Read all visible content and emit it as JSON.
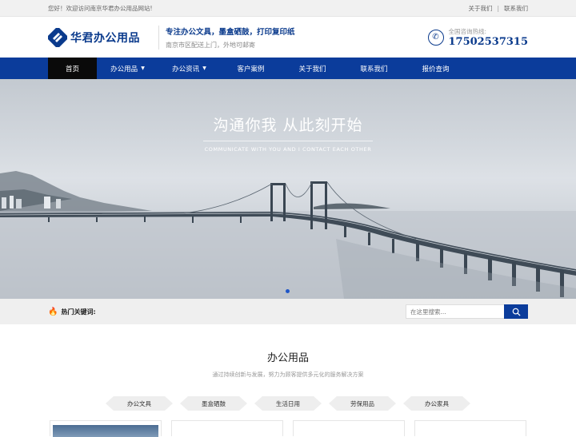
{
  "topbar": {
    "welcome": "您好！欢迎访问南京华君办公用品网站!",
    "links": [
      "关于我们",
      "联系我们"
    ],
    "separator": "|"
  },
  "header": {
    "logo_text": "华君办公用品",
    "slogan_line1": "专注办公文具，墨盒硒鼓，打印复印纸",
    "slogan_line2": "南京市区配送上门，外地可邮寄",
    "hotline_label": "全国咨询热线:",
    "hotline_number": "17502537315"
  },
  "nav": {
    "items": [
      {
        "label": "首页",
        "active": true,
        "dropdown": false
      },
      {
        "label": "办公用品",
        "active": false,
        "dropdown": true
      },
      {
        "label": "办公资讯",
        "active": false,
        "dropdown": true
      },
      {
        "label": "客户案例",
        "active": false,
        "dropdown": false
      },
      {
        "label": "关于我们",
        "active": false,
        "dropdown": false
      },
      {
        "label": "联系我们",
        "active": false,
        "dropdown": false
      },
      {
        "label": "报价查询",
        "active": false,
        "dropdown": false
      }
    ]
  },
  "banner": {
    "title": "沟通你我  从此刻开始",
    "subtitle": "COMMUNICATE WITH YOU AND I CONTACT EACH OTHER"
  },
  "keywords": {
    "label": "热门关键词:",
    "search_placeholder": "在这里搜索..."
  },
  "products": {
    "title": "办公用品",
    "description": "通过持续创新与发展，努力为顾客提供多元化的服务解决方案",
    "tabs": [
      "办公文具",
      "墨盒硒鼓",
      "生活日用",
      "劳保用品",
      "办公家具"
    ]
  },
  "colors": {
    "brand_blue": "#0b3c9b",
    "nav_active": "#0a0a0a",
    "fire_icon": "#e0441f"
  }
}
